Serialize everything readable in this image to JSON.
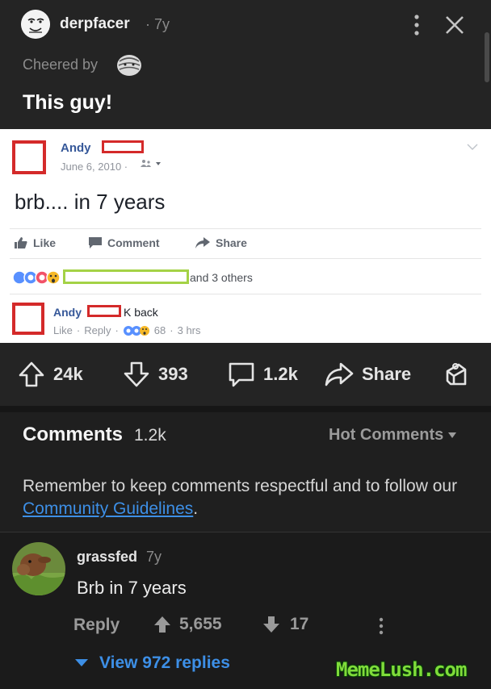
{
  "post": {
    "username": "derpfacer",
    "age": "· 7y",
    "cheered_label": "Cheered by",
    "title": "This guy!"
  },
  "fb_embed": {
    "name": "Andy",
    "date": "June 6, 2010 ·",
    "text": "brb.... in 7 years",
    "like_label": "Like",
    "comment_label": "Comment",
    "share_label": "Share",
    "reactions_text": "and 3 others",
    "reply_name": "Andy",
    "reply_text": "K back",
    "reply_like": "Like",
    "reply_reply": "Reply",
    "reply_count": "68",
    "reply_time": "3 hrs"
  },
  "vote_bar": {
    "upvotes": "24k",
    "downvotes": "393",
    "comments": "1.2k",
    "share_label": "Share"
  },
  "comments_header": {
    "title": "Comments",
    "count": "1.2k",
    "sort_label": "Hot Comments",
    "reminder_prefix": "Remember to keep comments respectful and to follow our ",
    "reminder_link": "Community Guidelines",
    "reminder_suffix": "."
  },
  "comment": {
    "username": "grassfed",
    "age": "7y",
    "body": "Brb in 7 years",
    "reply_label": "Reply",
    "upvotes": "5,655",
    "downvotes": "17",
    "view_replies": "View 972 replies"
  },
  "watermark": "MemeLush.com",
  "colors": {
    "background": "#1b1b1b",
    "link": "#3d8fe6",
    "redaction_red": "#d42a2a",
    "redaction_green": "#a4d246"
  }
}
